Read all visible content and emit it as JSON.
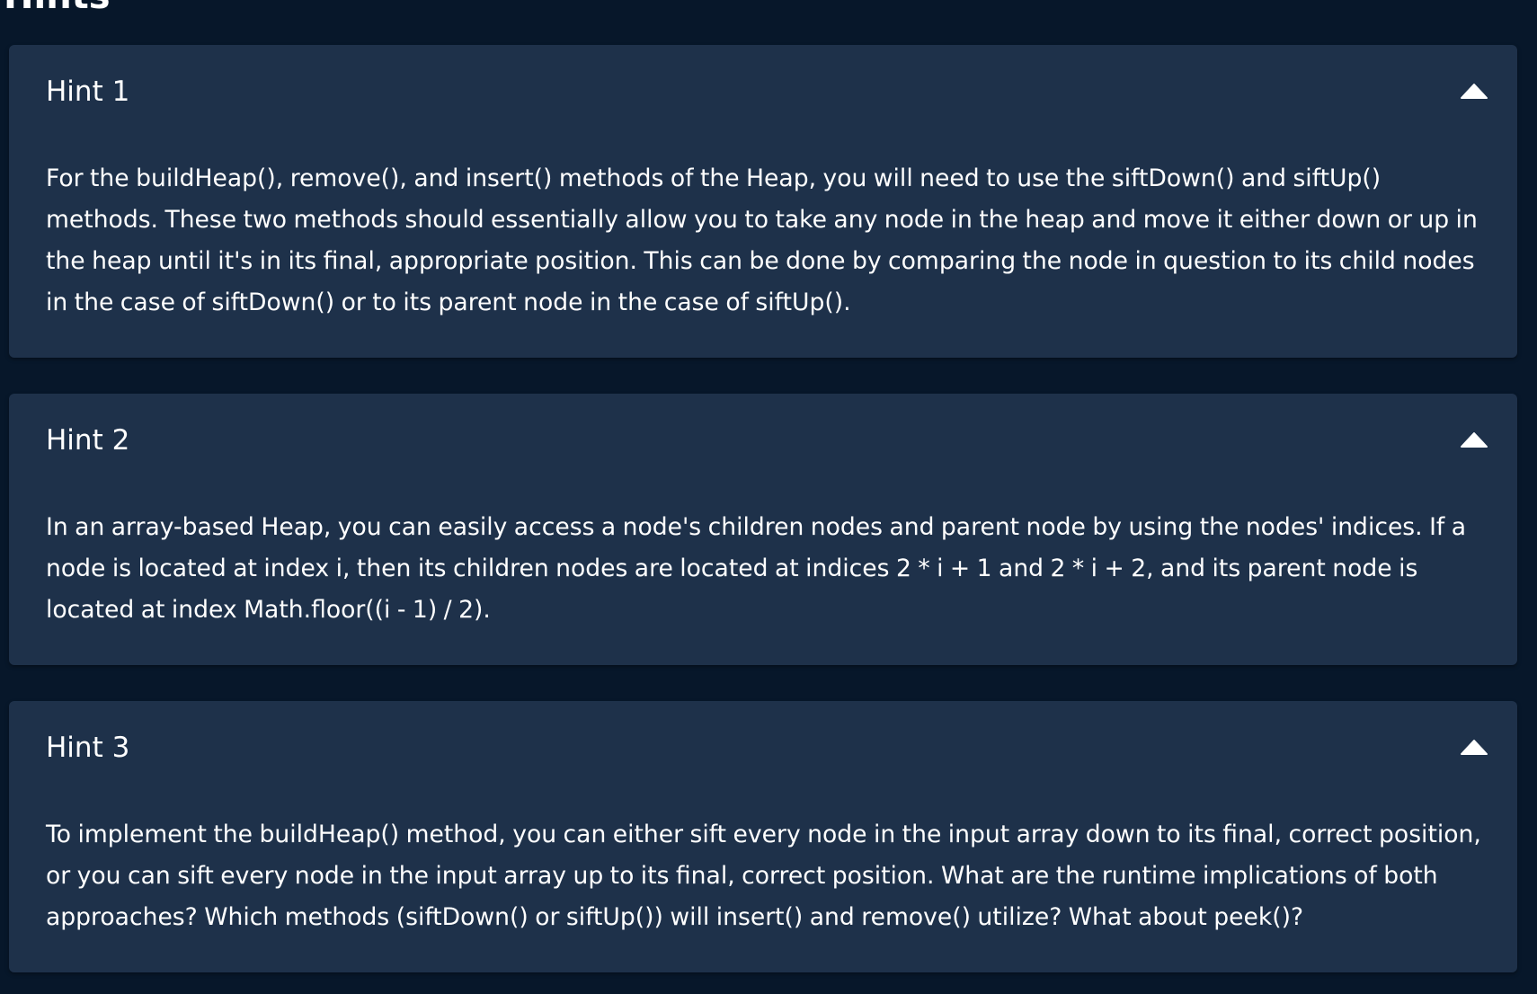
{
  "page": {
    "section_title": "Hints"
  },
  "hints": [
    {
      "title": "Hint 1",
      "expanded": true,
      "icon": "chevron-up-icon",
      "body": "For the buildHeap(), remove(), and insert() methods of the Heap, you will need to use the siftDown() and siftUp() methods. These two methods should essentially allow you to take any node in the heap and move it either down or up in the heap until it's in its final, appropriate position. This can be done by comparing the node in question to its child nodes in the case of siftDown() or to its parent node in the case of siftUp()."
    },
    {
      "title": "Hint 2",
      "expanded": true,
      "icon": "chevron-up-icon",
      "body": "In an array-based Heap, you can easily access a node's children nodes and parent node by using the nodes' indices. If a node is located at index i, then its children nodes are located at indices 2 * i + 1 and 2 * i + 2, and its parent node is located at index Math.floor((i - 1) / 2)."
    },
    {
      "title": "Hint 3",
      "expanded": true,
      "icon": "chevron-up-icon",
      "body": "To implement the buildHeap() method, you can either sift every node in the input array down to its final, correct position, or you can sift every node in the input array up to its final, correct position. What are the runtime implications of both approaches? Which methods (siftDown() or siftUp()) will insert() and remove() utilize? What about peek()?"
    }
  ],
  "colors": {
    "page_background": "#07172a",
    "card_background": "#1e314a",
    "text": "#ffffff"
  }
}
